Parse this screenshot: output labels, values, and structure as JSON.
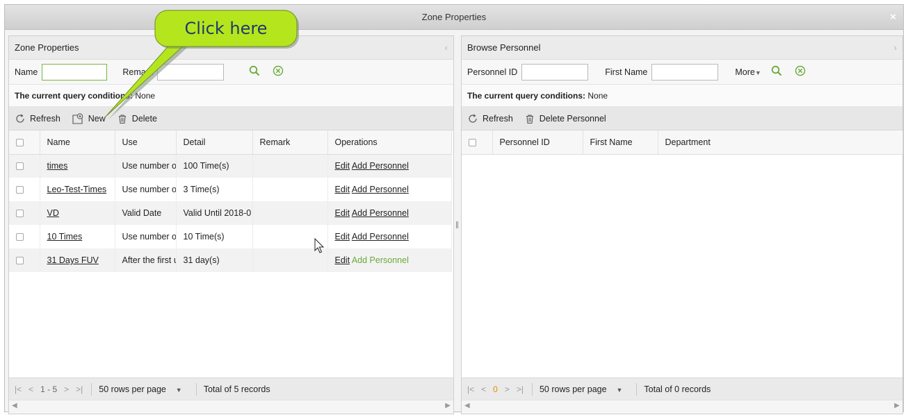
{
  "window": {
    "title": "Zone Properties",
    "close_label": "×"
  },
  "callout": {
    "text": "Click here"
  },
  "left": {
    "title": "Zone Properties",
    "collapse_arrow": "‹",
    "search": {
      "name_label": "Name",
      "name_value": "",
      "remark_label": "Remark",
      "remark_value": ""
    },
    "conditions_label": "The current query conditions:",
    "conditions_value": "None",
    "toolbar": {
      "refresh": "Refresh",
      "new": "New",
      "delete": "Delete"
    },
    "columns": [
      "Name",
      "Use",
      "Detail",
      "Remark",
      "Operations"
    ],
    "rows": [
      {
        "name": "times",
        "use": "Use number o",
        "detail": "100 Time(s)",
        "remark": "",
        "edit": "Edit",
        "add": "Add Personnel"
      },
      {
        "name": "Leo-Test-Times",
        "use": "Use number o",
        "detail": "3 Time(s)",
        "remark": "",
        "edit": "Edit",
        "add": "Add Personnel"
      },
      {
        "name": "VD",
        "use": "Valid Date",
        "detail": "Valid Until 2018-0",
        "remark": "",
        "edit": "Edit",
        "add": "Add Personnel"
      },
      {
        "name": "10 Times",
        "use": "Use number o",
        "detail": "10 Time(s)",
        "remark": "",
        "edit": "Edit",
        "add": "Add Personnel"
      },
      {
        "name": "31 Days FUV",
        "use": "After the first u",
        "detail": "31 day(s)",
        "remark": "",
        "edit": "Edit",
        "add": "Add Personnel"
      }
    ],
    "pager": {
      "range": "1 - 5",
      "rows_per_page": "50 rows per page",
      "total": "Total of 5 records"
    }
  },
  "right": {
    "title": "Browse Personnel",
    "collapse_arrow": "›",
    "search": {
      "id_label": "Personnel ID",
      "id_value": "",
      "first_name_label": "First Name",
      "first_name_value": "",
      "more_label": "More"
    },
    "conditions_label": "The current query conditions:",
    "conditions_value": "None",
    "toolbar": {
      "refresh": "Refresh",
      "delete": "Delete Personnel"
    },
    "columns": [
      "Personnel ID",
      "First Name",
      "Department"
    ],
    "pager": {
      "page": "0",
      "rows_per_page": "50 rows per page",
      "total": "Total of 0 records"
    }
  },
  "colors": {
    "accent_green": "#6aaa3a",
    "callout_fill": "#b5e61d",
    "page_orange": "#e58b00"
  }
}
